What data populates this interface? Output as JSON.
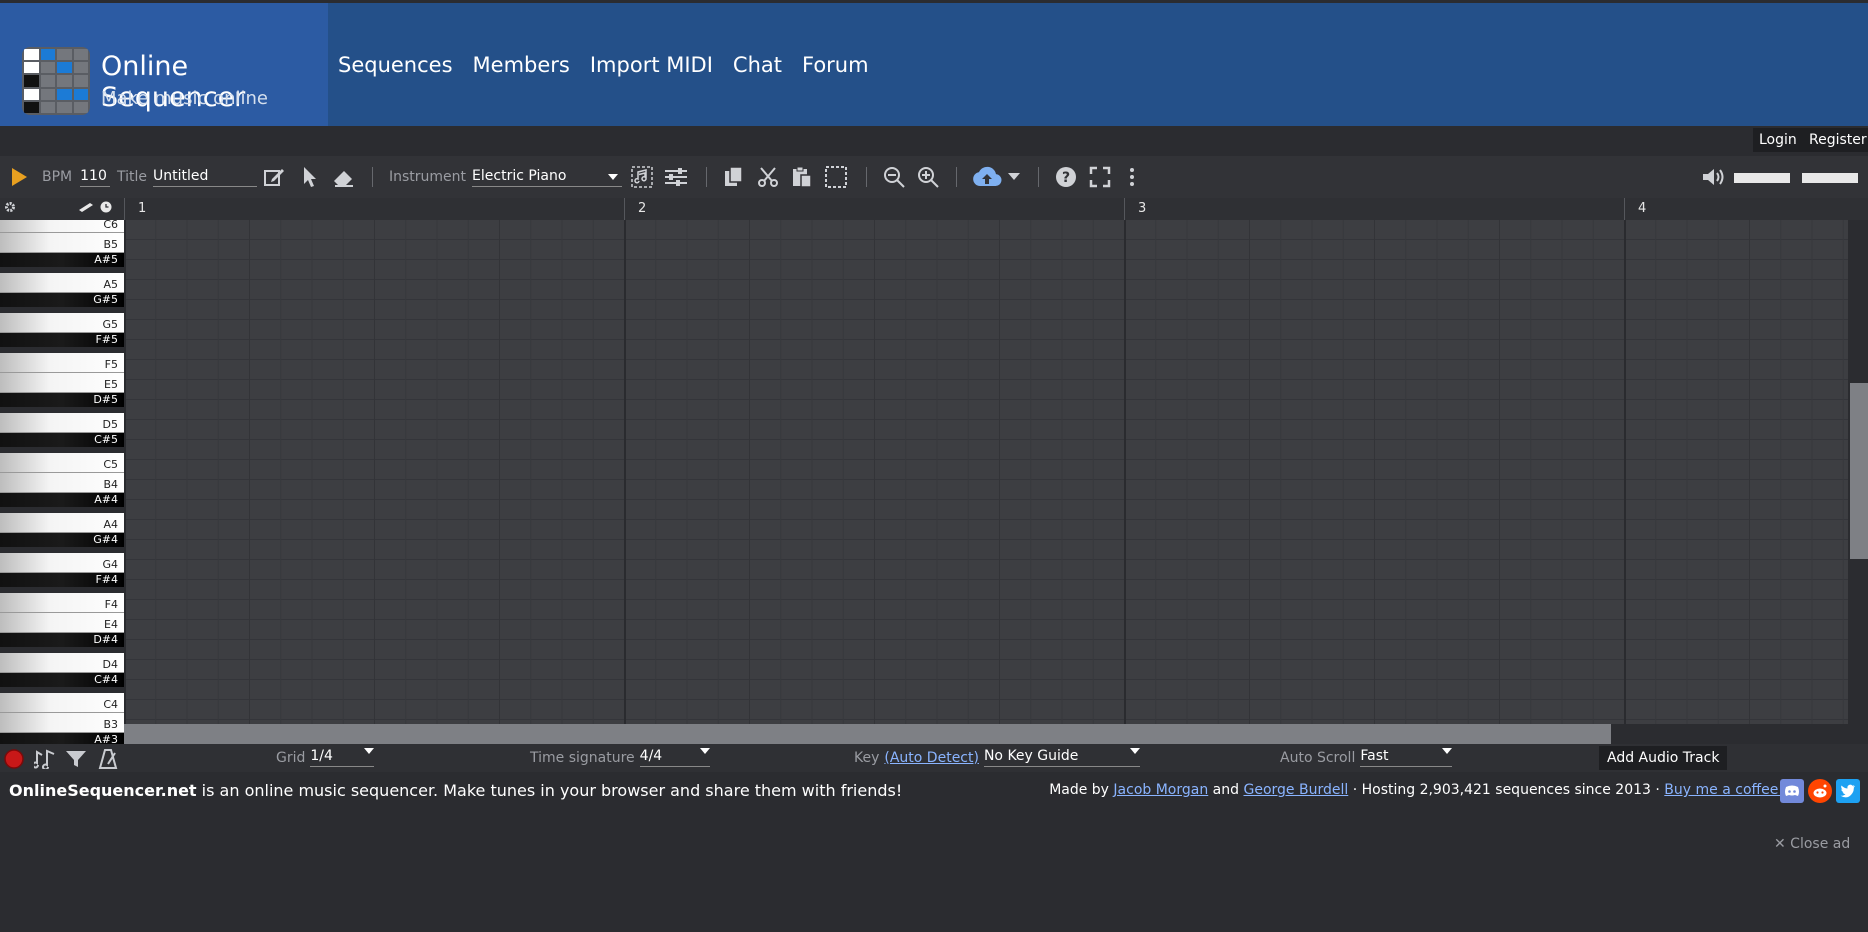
{
  "brand": {
    "title": "Online Sequencer",
    "subtitle": "Make music online"
  },
  "nav": [
    "Sequences",
    "Members",
    "Import MIDI",
    "Chat",
    "Forum"
  ],
  "user": {
    "login": "Login",
    "register": "Register"
  },
  "toolbar": {
    "bpm_label": "BPM",
    "bpm_value": "110",
    "title_label": "Title",
    "title_value": "Untitled",
    "instrument_label": "Instrument",
    "instrument_value": "Electric Piano"
  },
  "timeline": {
    "bars": [
      "1",
      "2",
      "3",
      "4"
    ]
  },
  "keys": [
    {
      "n": "C6",
      "t": "w"
    },
    {
      "n": "B5",
      "t": "w"
    },
    {
      "n": "A#5",
      "t": "b"
    },
    {
      "n": "A5",
      "t": "w"
    },
    {
      "n": "G#5",
      "t": "b"
    },
    {
      "n": "G5",
      "t": "w"
    },
    {
      "n": "F#5",
      "t": "b"
    },
    {
      "n": "F5",
      "t": "w"
    },
    {
      "n": "E5",
      "t": "w"
    },
    {
      "n": "D#5",
      "t": "b"
    },
    {
      "n": "D5",
      "t": "w"
    },
    {
      "n": "C#5",
      "t": "b"
    },
    {
      "n": "C5",
      "t": "w"
    },
    {
      "n": "B4",
      "t": "w"
    },
    {
      "n": "A#4",
      "t": "b"
    },
    {
      "n": "A4",
      "t": "w"
    },
    {
      "n": "G#4",
      "t": "b"
    },
    {
      "n": "G4",
      "t": "w"
    },
    {
      "n": "F#4",
      "t": "b"
    },
    {
      "n": "F4",
      "t": "w"
    },
    {
      "n": "E4",
      "t": "w"
    },
    {
      "n": "D#4",
      "t": "b"
    },
    {
      "n": "D4",
      "t": "w"
    },
    {
      "n": "C#4",
      "t": "b"
    },
    {
      "n": "C4",
      "t": "w"
    },
    {
      "n": "B3",
      "t": "w"
    },
    {
      "n": "A#3",
      "t": "b"
    }
  ],
  "bottom": {
    "grid_label": "Grid",
    "grid_value": "1/4",
    "timesig_label": "Time signature",
    "timesig_value": "4/4",
    "key_label": "Key",
    "key_link": "(Auto Detect)",
    "key_value": "No Key Guide",
    "autoscroll_label": "Auto Scroll",
    "autoscroll_value": "Fast",
    "add_audio_track": "Add Audio Track"
  },
  "footer": {
    "site": "OnlineSequencer.net",
    "tagline": " is an online music sequencer. Make tunes in your browser and share them with friends!",
    "made_by": "Made by ",
    "author1": "Jacob Morgan",
    "and": " and ",
    "author2": "George Burdell",
    "hosting": " · Hosting 2,903,421 sequences since 2013 · ",
    "coffee": "Buy me a coffee!",
    "close_ad": "✕ Close ad"
  },
  "colors": {
    "header": "#245089",
    "brand_bg": "#2c5ba3",
    "accent_play": "#e8a020",
    "link": "#8ab4ff"
  }
}
